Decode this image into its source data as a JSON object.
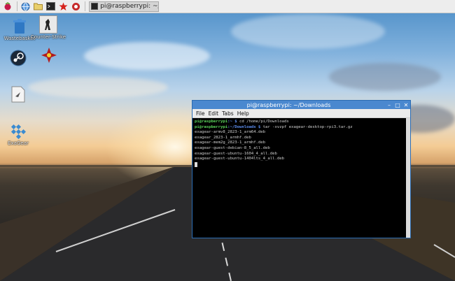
{
  "taskbar": {
    "icons": [
      "raspberry-icon",
      "globe-icon",
      "folder-icon",
      "terminal-icon",
      "wolfram-icon",
      "mathematica-icon"
    ],
    "task_label": "pi@raspberrypi: ~/D..."
  },
  "desktop_icons": [
    {
      "name": "wastebasket",
      "label": "Wastebasket",
      "icon": "trash-icon"
    },
    {
      "name": "counter-strike",
      "label": "Counter-Strike",
      "icon": "counter-strike-icon"
    },
    {
      "name": "steam",
      "label": "",
      "icon": "steam-icon"
    },
    {
      "name": "starship",
      "label": "",
      "icon": "ship-icon"
    },
    {
      "name": "document",
      "label": "",
      "icon": "document-icon"
    },
    {
      "name": "exagear",
      "label": "ExaGear",
      "icon": "exagear-icon"
    }
  ],
  "terminal": {
    "title": "pi@raspberrypi: ~/Downloads",
    "menu": [
      "File",
      "Edit",
      "Tabs",
      "Help"
    ],
    "lines": [
      {
        "user": "pi@raspberrypi",
        "path": ":~ $",
        "cmd": " cd /home/pi/Downloads"
      },
      {
        "user": "pi@raspberrypi",
        "path": ":~/Downloads $",
        "cmd": " tar -xvzpf exagear-desktop-rpi3.tar.gz"
      },
      {
        "text": "exagear-armv8_2823-1_arm64.deb"
      },
      {
        "text": "exagear_2823-1_armhf.deb"
      },
      {
        "text": "exagear-mem2g_2823-1_armhf.deb"
      },
      {
        "text": "exagear-guest-debian-8_5_all.deb"
      },
      {
        "text": "exagear-guest-ubuntu-1604_4_all.deb"
      },
      {
        "text": "exagear-guest-ubuntu-1404lts_4_all.deb"
      }
    ],
    "colors": {
      "user": "#5ad35a",
      "path": "#5d8ef0",
      "title_bar": "#4a88cf"
    }
  }
}
